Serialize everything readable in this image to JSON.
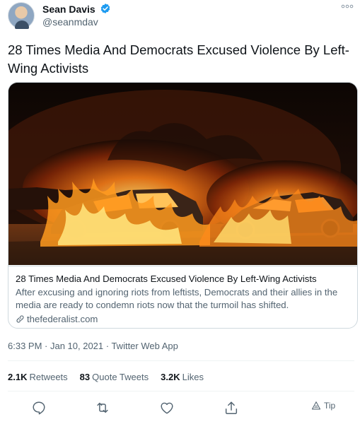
{
  "author": {
    "name": "Sean Davis",
    "handle": "@seanmdav",
    "verified": true
  },
  "tweet": {
    "text": "28 Times Media And Democrats Excused Violence By Left-Wing Activists",
    "timestamp": "6:33 PM · Jan 10, 2021 · Twitter Web App"
  },
  "card": {
    "title": "28 Times Media And Democrats Excused Violence By Left-Wing Activists",
    "description": "After excusing and ignoring riots from leftists, Democrats and their allies in the media are ready to condemn riots now that the turmoil has shifted.",
    "domain": "thefederalist.com"
  },
  "stats": {
    "retweets_count": "2.1K",
    "retweets_label": "Retweets",
    "quotes_count": "83",
    "quotes_label": "Quote Tweets",
    "likes_count": "3.2K",
    "likes_label": "Likes"
  },
  "actions": {
    "tip_label": "Tip"
  },
  "colors": {
    "verified": "#1d9bf0",
    "icon": "#536471"
  }
}
